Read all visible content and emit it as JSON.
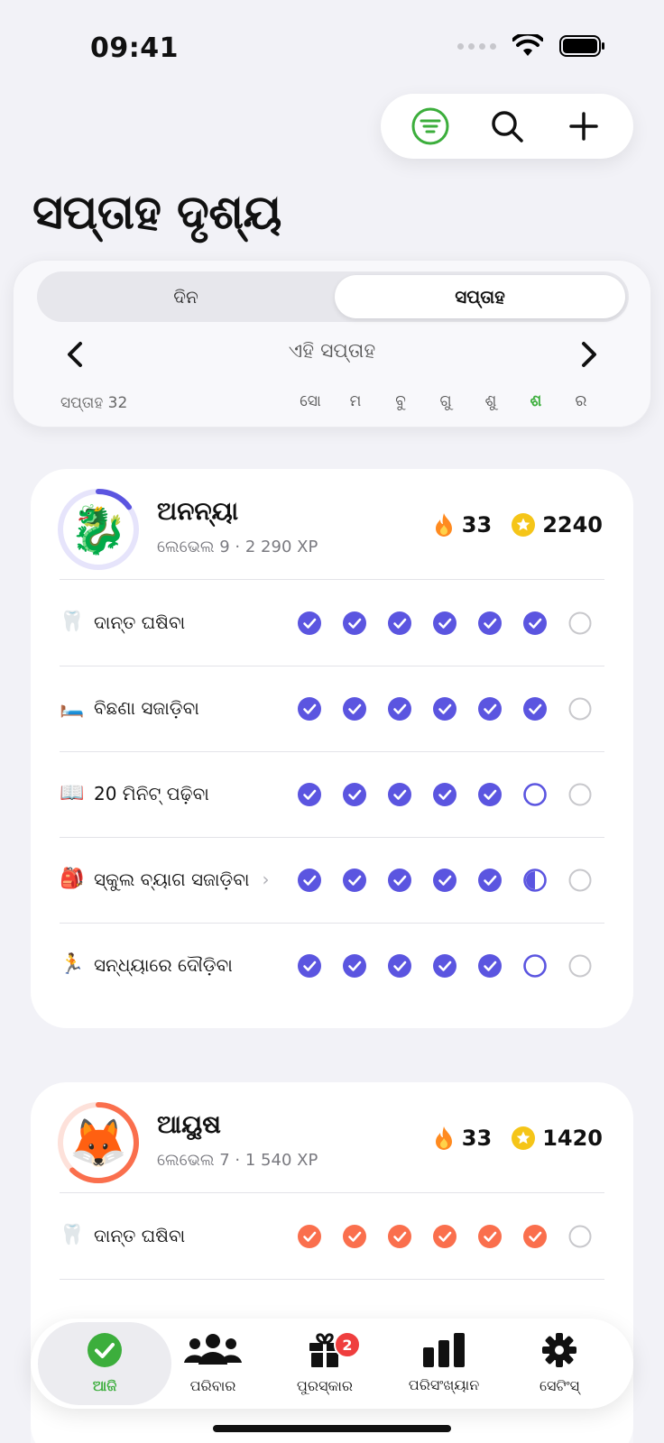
{
  "status": {
    "time": "09:41"
  },
  "page": {
    "title": "ସପ୍ତାହ ଦୃଶ୍ୟ"
  },
  "segment": {
    "day": "ଦିନ",
    "week": "ସପ୍ତାହ"
  },
  "week_nav": {
    "label": "ଏହି ସପ୍ତାହ",
    "week_number": "ସପ୍ତାହ 32"
  },
  "days": [
    "ସୋ",
    "ମ",
    "ବୁ",
    "ଗୁ",
    "ଶୁ",
    "ଶ",
    "ର"
  ],
  "today_index": 5,
  "colors": {
    "accent_green": "#3cae3c",
    "purple": "#5b55e0",
    "coral": "#fa6f4d",
    "badge_red": "#ef3e3e"
  },
  "members": [
    {
      "name": "ଅନନ୍ୟା",
      "avatar": "🐉",
      "level": "ଲେଭେଲ 9 · 2 290 XP",
      "streak": "33",
      "points": "2240",
      "ring_progress": 0.15,
      "tasks": [
        {
          "emoji": "🦷",
          "label": "ଦାନ୍ତ ଘଷିବା",
          "has_chevron": false,
          "status": [
            "done",
            "done",
            "done",
            "done",
            "done",
            "done",
            "empty"
          ]
        },
        {
          "emoji": "🛏️",
          "label": "ବିଛଣା ସଜାଡ଼ିବା",
          "has_chevron": false,
          "status": [
            "done",
            "done",
            "done",
            "done",
            "done",
            "done",
            "empty"
          ]
        },
        {
          "emoji": "📖",
          "label": "20 ମିନିଟ୍ ପଢ଼ିବା",
          "has_chevron": false,
          "status": [
            "done",
            "done",
            "done",
            "done",
            "done",
            "pending",
            "empty"
          ]
        },
        {
          "emoji": "🎒",
          "label": "ସ୍କୁଲ ବ୍ୟାଗ ସଜାଡ଼ିବା",
          "has_chevron": true,
          "status": [
            "done",
            "done",
            "done",
            "done",
            "done",
            "half",
            "empty"
          ]
        },
        {
          "emoji": "🏃",
          "label": "ସନ୍ଧ୍ୟାରେ ଦୌଡ଼ିବା",
          "has_chevron": false,
          "status": [
            "done",
            "done",
            "done",
            "done",
            "done",
            "pending",
            "empty"
          ]
        }
      ]
    },
    {
      "name": "ଆୟୁଷ",
      "avatar": "🦊",
      "level": "ଲେଭେଲ 7 · 1 540 XP",
      "streak": "33",
      "points": "1420",
      "ring_progress": 0.62,
      "tasks": [
        {
          "emoji": "🦷",
          "label": "ଦାନ୍ତ ଘଷିବା",
          "has_chevron": false,
          "status": [
            "done",
            "done",
            "done",
            "done",
            "done",
            "done",
            "empty"
          ]
        }
      ]
    }
  ],
  "tabbar": {
    "items": [
      {
        "label": "ଆଜି",
        "icon": "check-circle-icon",
        "active": true
      },
      {
        "label": "ପରିବାର",
        "icon": "people-icon",
        "active": false
      },
      {
        "label": "ପୁରସ୍କାର",
        "icon": "gift-icon",
        "active": false,
        "badge": "2"
      },
      {
        "label": "ପରିସଂଖ୍ୟାନ",
        "icon": "bar-chart-icon",
        "active": false
      },
      {
        "label": "ସେଟିଂସ୍",
        "icon": "gear-icon",
        "active": false
      }
    ]
  }
}
